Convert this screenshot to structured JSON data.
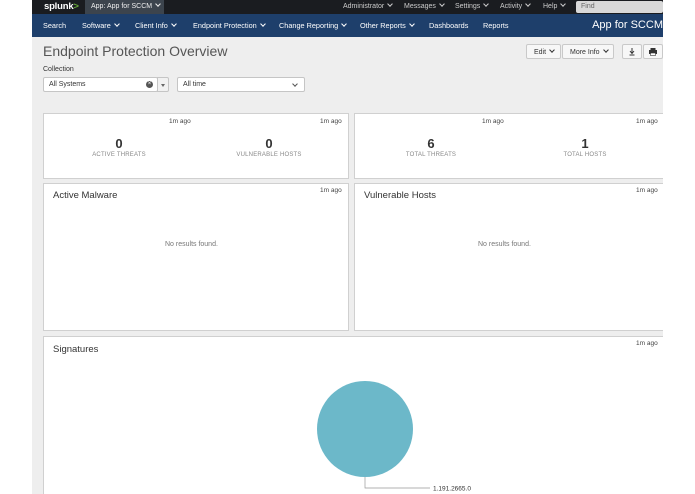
{
  "topbar": {
    "logo": "splunk",
    "logo_mark": ">",
    "app_button": "App: App for SCCM",
    "menus": [
      "Administrator",
      "Messages",
      "Settings",
      "Activity",
      "Help"
    ],
    "find_placeholder": "Find"
  },
  "navbar": {
    "items": [
      "Search",
      "Software",
      "Client Info",
      "Endpoint Protection",
      "Change Reporting",
      "Other Reports",
      "Dashboards",
      "Reports"
    ],
    "app_title": "App for SCCM"
  },
  "page": {
    "title": "Endpoint Protection Overview",
    "edit_label": "Edit",
    "more_info_label": "More Info",
    "collection_label": "Collection",
    "collection_value": "All Systems",
    "time_value": "All time"
  },
  "panels": {
    "threats": {
      "ago_left": "1m ago",
      "ago_right": "1m ago",
      "active_threats_value": "0",
      "active_threats_label": "ACTIVE THREATS",
      "vulnerable_hosts_value": "0",
      "vulnerable_hosts_label": "VULNERABLE HOSTS"
    },
    "totals": {
      "ago_left": "1m ago",
      "ago_right": "1m ago",
      "total_threats_value": "6",
      "total_threats_label": "TOTAL THREATS",
      "total_hosts_value": "1",
      "total_hosts_label": "TOTAL HOSTS"
    },
    "active_malware": {
      "title": "Active Malware",
      "ago": "1m ago",
      "empty": "No results found."
    },
    "vulnerable_hosts": {
      "title": "Vulnerable Hosts",
      "ago": "1m ago",
      "empty": "No results found."
    },
    "signatures": {
      "title": "Signatures",
      "ago": "1m ago",
      "pie_color": "#6cb8c9"
    }
  },
  "chart_data": {
    "type": "pie",
    "categories": [
      "1.191.2665.0"
    ],
    "values": [
      100
    ]
  }
}
